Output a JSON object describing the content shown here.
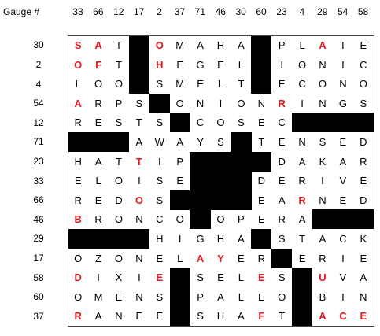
{
  "header": {
    "corner_label": "Gauge #",
    "column_gauges": [
      "33",
      "66",
      "12",
      "17",
      "2",
      "37",
      "71",
      "46",
      "30",
      "60",
      "23",
      "4",
      "29",
      "54",
      "58"
    ]
  },
  "row_gauges": [
    "30",
    "2",
    "4",
    "54",
    "12",
    "71",
    "23",
    "33",
    "66",
    "46",
    "29",
    "17",
    "58",
    "60",
    "37"
  ],
  "grid_rows": [
    "SAT#OMAHA#PLATE",
    "OFT#HEGEL#IONIC",
    "LOO#SMELT#ECONO",
    "ARPS#ONIONRINGS",
    "RESTS#COSEC####",
    "##AWAYS#TENSED",
    "HATTIP###DAKAR",
    "ELOISE###DERIVE",
    "REDOS###EARNED",
    "BRONCO#OPERA###",
    "###HIGHA#STACK",
    "OZONELAYER#ERIE",
    "DIXIE#SELES#UVA",
    "OMENS#PALEO#BIN",
    "RANEE#SHAFT#ACE"
  ],
  "highlight_color": "#e8191f"
}
